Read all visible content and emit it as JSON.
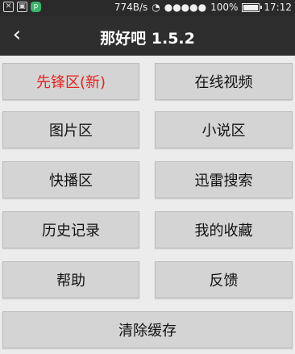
{
  "status_bar": {
    "icons": [
      "x",
      "gallery",
      "p"
    ],
    "net_speed": "774B/s",
    "battery_level": "100%",
    "battery_fill_fraction": 1.0,
    "time": "17:12"
  },
  "header": {
    "back_icon": "‹",
    "title": "那好吧 1.5.2"
  },
  "menu": {
    "pioneer": "先锋区(新)",
    "online_video": "在线视频",
    "images": "图片区",
    "novels": "小说区",
    "quick_play": "快播区",
    "thunder_search": "迅雷搜索",
    "history": "历史记录",
    "favorites": "我的收藏",
    "help": "帮助",
    "feedback": "反馈",
    "clear_cache": "清除缓存"
  },
  "colors": {
    "accent": "#e8231f",
    "button_bg": "#d4d4d4",
    "app_bar": "#2e2e2e"
  }
}
